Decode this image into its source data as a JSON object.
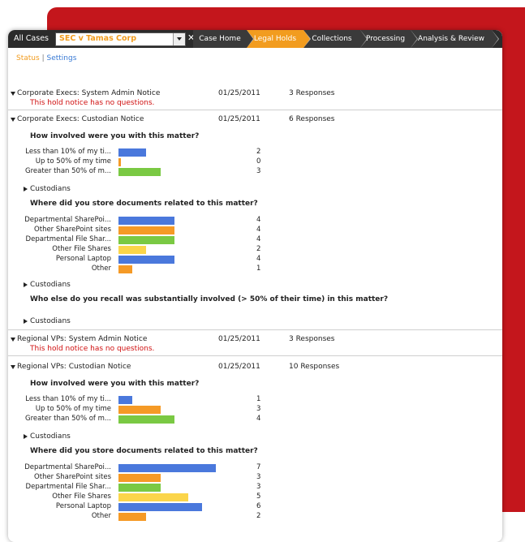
{
  "nav": {
    "all_cases": "All Cases",
    "case_name": "SEC v Tamas Corp",
    "close": "✕",
    "tabs": [
      {
        "label": "Case Home",
        "active": false
      },
      {
        "label": "Legal Holds",
        "active": true
      },
      {
        "label": "Collections",
        "active": false
      },
      {
        "label": "Processing",
        "active": false
      },
      {
        "label": "Analysis & Review",
        "active": false
      }
    ]
  },
  "subnav": {
    "status": "Status",
    "sep": "|",
    "settings": "Settings"
  },
  "colors": {
    "blue": "#4a78dc",
    "orange": "#f59a26",
    "green": "#7ac943",
    "yellow": "#fbd54a",
    "red_text": "#d01010",
    "accent": "#f29c1f"
  },
  "notices": [
    {
      "name": "Corporate Execs: System Admin Notice",
      "date": "01/25/2011",
      "responses": "3 Responses",
      "no_questions": "This hold notice has no questions."
    },
    {
      "name": "Corporate Execs: Custodian Notice",
      "date": "01/25/2011",
      "responses": "6 Responses",
      "q1": "How involved were you with this matter?",
      "q1_bars": [
        {
          "label": "Less than 10% of my ti...",
          "count": "2",
          "value": 2,
          "color": "blue"
        },
        {
          "label": "Up to 50% of my time",
          "count": "0",
          "value": 0,
          "color": "orange"
        },
        {
          "label": "Greater than 50% of m...",
          "count": "3",
          "value": 3,
          "color": "green"
        }
      ],
      "custodians": "Custodians",
      "q2": "Where did you store documents related to this matter?",
      "q2_bars": [
        {
          "label": "Departmental SharePoi...",
          "count": "4",
          "value": 4,
          "color": "blue"
        },
        {
          "label": "Other SharePoint sites",
          "count": "4",
          "value": 4,
          "color": "orange"
        },
        {
          "label": "Departmental File Shar...",
          "count": "4",
          "value": 4,
          "color": "green"
        },
        {
          "label": "Other File Shares",
          "count": "2",
          "value": 2,
          "color": "yellow"
        },
        {
          "label": "Personal Laptop",
          "count": "4",
          "value": 4,
          "color": "blue"
        },
        {
          "label": "Other",
          "count": "1",
          "value": 1,
          "color": "orange"
        }
      ],
      "custodians2": "Custodians",
      "q3": "Who else do you recall was substantially involved (> 50% of their time) in this matter?",
      "custodians3": "Custodians"
    },
    {
      "name": "Regional VPs: System Admin Notice",
      "date": "01/25/2011",
      "responses": "3 Responses",
      "no_questions": "This hold notice has no questions."
    },
    {
      "name": "Regional VPs: Custodian Notice",
      "date": "01/25/2011",
      "responses": "10 Responses",
      "q1": "How involved were you with this matter?",
      "q1_bars": [
        {
          "label": "Less than 10% of my ti...",
          "count": "1",
          "value": 1,
          "color": "blue"
        },
        {
          "label": "Up to 50% of my time",
          "count": "3",
          "value": 3,
          "color": "orange"
        },
        {
          "label": "Greater than 50% of m...",
          "count": "4",
          "value": 4,
          "color": "green"
        }
      ],
      "custodians": "Custodians",
      "q2": "Where did you store documents related to this matter?",
      "q2_bars": [
        {
          "label": "Departmental SharePoi...",
          "count": "7",
          "value": 7,
          "color": "blue"
        },
        {
          "label": "Other SharePoint sites",
          "count": "3",
          "value": 3,
          "color": "orange"
        },
        {
          "label": "Departmental File Shar...",
          "count": "3",
          "value": 3,
          "color": "green"
        },
        {
          "label": "Other File Shares",
          "count": "5",
          "value": 5,
          "color": "yellow"
        },
        {
          "label": "Personal Laptop",
          "count": "6",
          "value": 6,
          "color": "blue"
        },
        {
          "label": "Other",
          "count": "2",
          "value": 2,
          "color": "orange"
        }
      ]
    }
  ]
}
